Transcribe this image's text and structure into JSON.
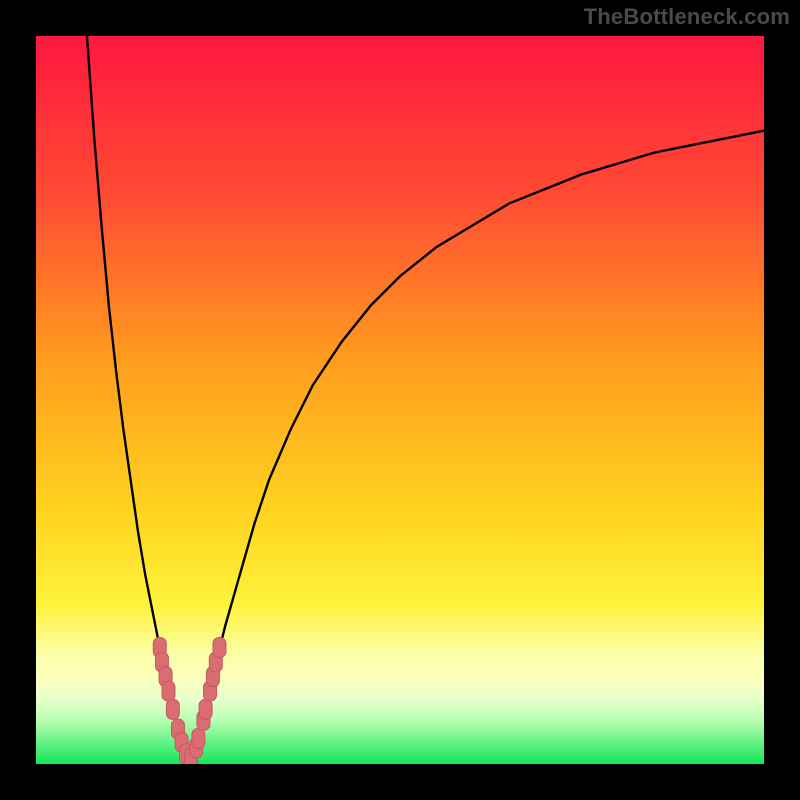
{
  "watermark": "TheBottleneck.com",
  "colors": {
    "frame": "#000000",
    "curve": "#000000",
    "marker_fill": "#d96d72",
    "marker_stroke": "#c45a60",
    "gradient_top": "#ff173f",
    "gradient_mid1": "#ff6a2a",
    "gradient_mid2": "#ffd21f",
    "gradient_mid3": "#fff23a",
    "gradient_mid4": "#f6ff7a",
    "gradient_band": "#fbffb8",
    "gradient_green": "#12e65a"
  },
  "chart_data": {
    "type": "line",
    "title": "",
    "xlabel": "",
    "ylabel": "",
    "xlim": [
      0,
      100
    ],
    "ylim": [
      0,
      100
    ],
    "x_optimum": 21,
    "series": [
      {
        "name": "left_branch",
        "x": [
          7,
          8,
          9,
          10,
          11,
          12,
          13,
          14,
          15,
          16,
          17,
          18,
          19,
          20,
          21
        ],
        "values": [
          100,
          86,
          74,
          63,
          54,
          46,
          39,
          32,
          26,
          21,
          16,
          11,
          7,
          3,
          0
        ]
      },
      {
        "name": "right_branch",
        "x": [
          21,
          22,
          23,
          24,
          25,
          26,
          28,
          30,
          32,
          35,
          38,
          42,
          46,
          50,
          55,
          60,
          65,
          70,
          75,
          80,
          85,
          90,
          95,
          100
        ],
        "values": [
          0,
          3,
          7,
          11,
          15,
          19,
          26,
          33,
          39,
          46,
          52,
          58,
          63,
          67,
          71,
          74,
          77,
          79,
          81,
          82.5,
          84,
          85,
          86,
          87
        ]
      }
    ],
    "markers": {
      "name": "highlight_points",
      "points": [
        {
          "x": 17.0,
          "y": 16
        },
        {
          "x": 17.3,
          "y": 14
        },
        {
          "x": 17.8,
          "y": 12
        },
        {
          "x": 18.2,
          "y": 10
        },
        {
          "x": 18.8,
          "y": 7.5
        },
        {
          "x": 19.5,
          "y": 4.8
        },
        {
          "x": 20.0,
          "y": 3.0
        },
        {
          "x": 20.6,
          "y": 1.4
        },
        {
          "x": 21.3,
          "y": 0.8
        },
        {
          "x": 22.0,
          "y": 2.2
        },
        {
          "x": 22.3,
          "y": 3.5
        },
        {
          "x": 23.0,
          "y": 6.0
        },
        {
          "x": 23.3,
          "y": 7.5
        },
        {
          "x": 23.9,
          "y": 10.0
        },
        {
          "x": 24.3,
          "y": 12.0
        },
        {
          "x": 24.7,
          "y": 14.0
        },
        {
          "x": 25.2,
          "y": 16.0
        }
      ]
    }
  }
}
